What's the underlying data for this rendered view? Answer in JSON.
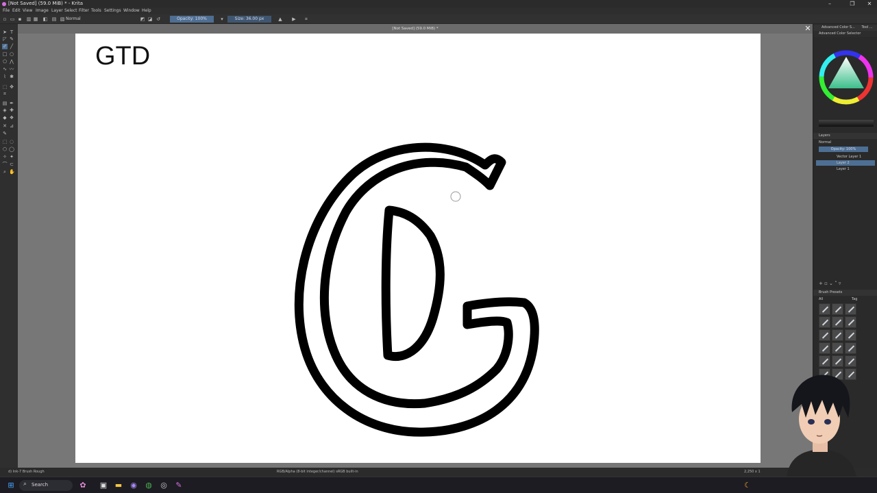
{
  "window": {
    "title": "[Not Saved]  (59.0 MiB) * - Krita",
    "controls": [
      "–",
      "❐",
      "✕"
    ]
  },
  "menu": [
    "File",
    "Edit",
    "View",
    "Image",
    "Layer",
    "Select",
    "Filter",
    "Tools",
    "Settings",
    "Window",
    "Help"
  ],
  "toolbar": {
    "blend_mode": "Normal",
    "opacity": "Opacity: 100%",
    "size": "Size: 36.00 px"
  },
  "document": {
    "tab_title": "[Not Saved]  (59.0 MiB) *",
    "close_glyph": "✕",
    "text_on_canvas": "GTD"
  },
  "dockers": {
    "color_selector_tabs": [
      "Advanced Color S...",
      "Tool ..."
    ],
    "color_selector_title": "Advanced Color Selector",
    "layers_title": "Layers",
    "layers_blend": "Normal",
    "layers_opacity": "Opacity: 100%",
    "layers": [
      {
        "name": "Vector Layer 1",
        "selected": false
      },
      {
        "name": "Layer 2",
        "selected": true
      },
      {
        "name": "Layer 1",
        "selected": false
      }
    ],
    "brush_presets_title": "Brush Presets",
    "brush_filter": "All",
    "brush_tag": "Tag"
  },
  "status": {
    "brush": "d) Ink-7 Brush Rough",
    "color_info": "RGB/Alpha (8-bit integer/channel)  sRGB built-in",
    "dimensions": "2,250 x 1"
  },
  "taskbar": {
    "search_label": "Search"
  }
}
